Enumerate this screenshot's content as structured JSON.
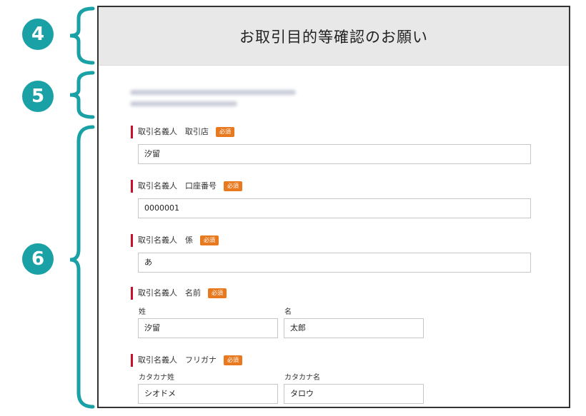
{
  "callouts": {
    "header": "4",
    "intro": "5",
    "form": "6"
  },
  "header": {
    "title": "お取引目的等確認のお願い"
  },
  "colors": {
    "callout": "#1aa1a6",
    "required_badge": "#e8791f",
    "label_marker": "#c8102e",
    "header_bg": "#e8e8e8"
  },
  "form": {
    "required_label": "必須",
    "branch": {
      "label": "取引名義人　取引店",
      "value": "汐留"
    },
    "account": {
      "label": "取引名義人　口座番号",
      "value": "0000001"
    },
    "department": {
      "label": "取引名義人　係",
      "value": "あ"
    },
    "name": {
      "label": "取引名義人　名前",
      "last_label": "姓",
      "last_value": "汐留",
      "first_label": "名",
      "first_value": "太郎"
    },
    "furigana": {
      "label": "取引名義人　フリガナ",
      "last_label": "カタカナ姓",
      "last_value": "シオドメ",
      "first_label": "カタカナ名",
      "first_value": "タロウ"
    }
  }
}
